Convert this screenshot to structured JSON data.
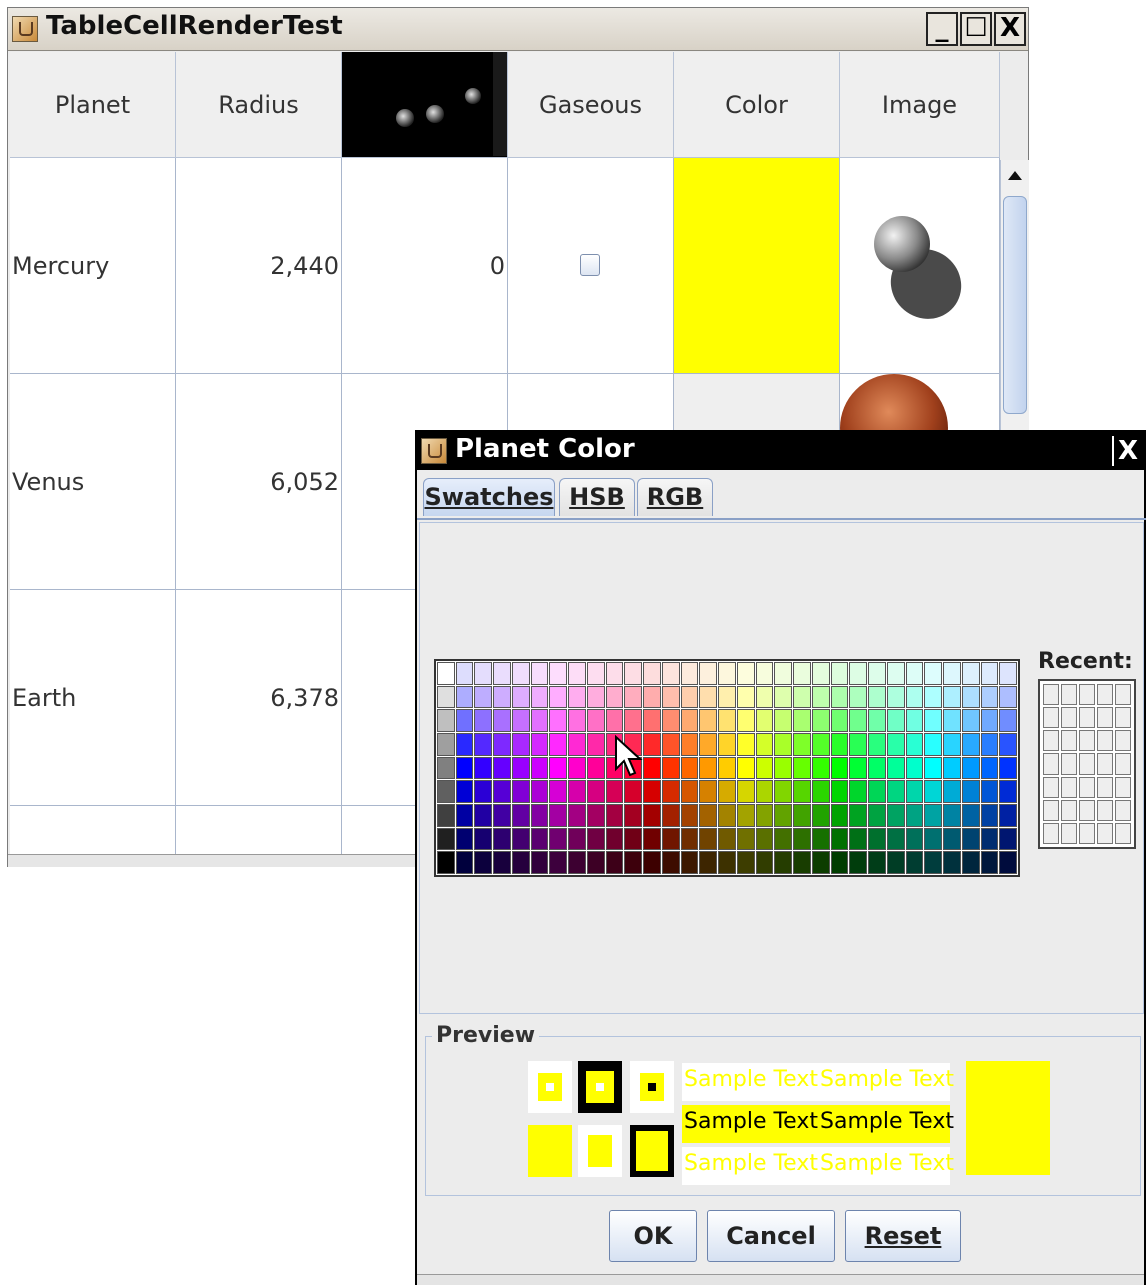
{
  "main_window": {
    "title": "TableCellRenderTest",
    "controls": {
      "minimize": "_",
      "maximize": "☐",
      "close": "X"
    }
  },
  "table": {
    "columns": [
      "Planet",
      "Radius",
      "",
      "Gaseous",
      "Color",
      "Image"
    ],
    "rows": [
      {
        "planet": "Mercury",
        "radius": "2,440",
        "moons": "0",
        "gaseous": false,
        "color": "#ffff00"
      },
      {
        "planet": "Venus",
        "radius": "6,052",
        "moons": "",
        "gaseous": false,
        "color": ""
      },
      {
        "planet": "Earth",
        "radius": "6,378",
        "moons": "",
        "gaseous": false,
        "color": ""
      }
    ]
  },
  "dialog": {
    "title": "Planet Color",
    "close": "X",
    "tabs": [
      {
        "label": "Swatches",
        "active": true
      },
      {
        "label": "HSB",
        "active": false
      },
      {
        "label": "RGB",
        "active": false
      }
    ],
    "recent_label": "Recent:",
    "preview_label": "Preview",
    "sample_text": "Sample Text",
    "selected_color": "#ffff00",
    "buttons": {
      "ok": "OK",
      "cancel": "Cancel",
      "reset": "Reset"
    }
  }
}
